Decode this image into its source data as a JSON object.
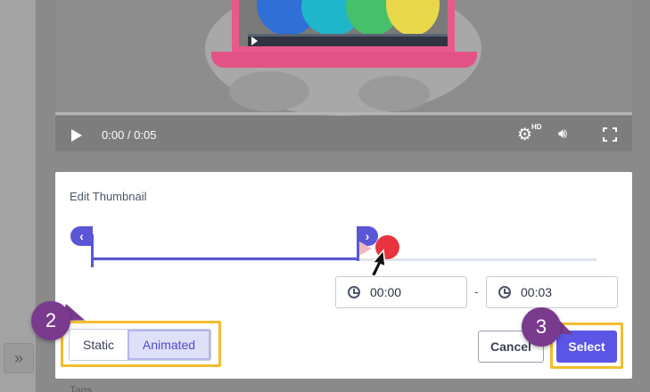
{
  "video": {
    "time_display": "0:00 / 0:05",
    "hd_badge": "HD"
  },
  "panel": {
    "title": "Edit Thumbnail",
    "start_time": "00:00",
    "end_time": "00:03",
    "separator": "-",
    "toggle_static": "Static",
    "toggle_animated": "Animated",
    "toggle_selected": "Animated",
    "cancel_label": "Cancel",
    "select_label": "Select"
  },
  "annotations": {
    "step_2": "2",
    "step_3": "3",
    "highlight_color": "#f2bd2d",
    "badge_color": "#7a3a8e"
  },
  "below": {
    "tags_label": "Tags"
  },
  "sidebar": {
    "expand_icon": "double-chevron-right-icon"
  }
}
